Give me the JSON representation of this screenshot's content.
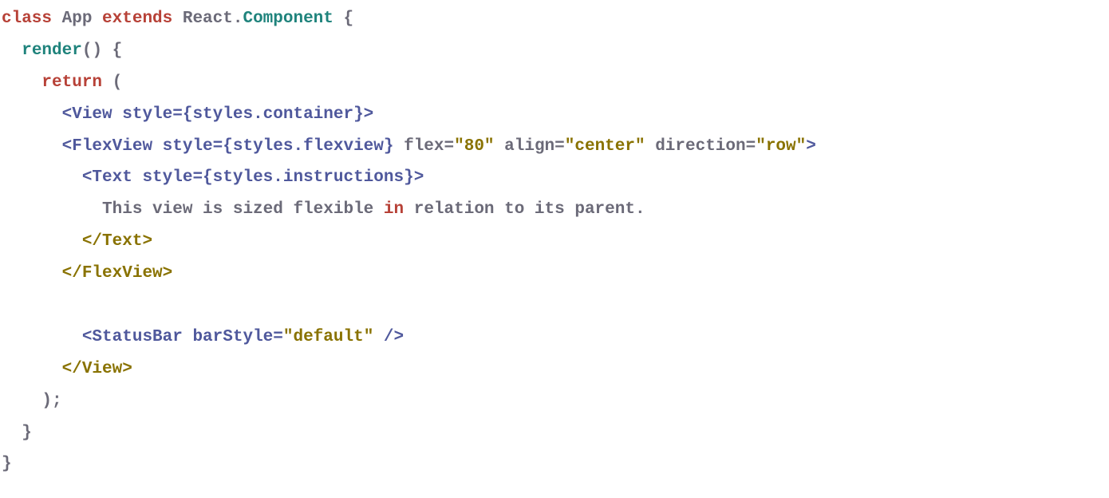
{
  "code": {
    "l1": {
      "a": "class",
      "b": " App ",
      "c": "extends",
      "d": " React.",
      "e": "Component",
      "f": " {"
    },
    "l2": {
      "a": "  ",
      "b": "render",
      "c": "() {"
    },
    "l3": {
      "a": "    ",
      "b": "return",
      "c": " ("
    },
    "l4": {
      "a": "      ",
      "b": "<View style={styles.container}>"
    },
    "l5": {
      "a": "      ",
      "b": "<FlexView style={styles.flexview}",
      "c": " flex=",
      "d": "\"80\"",
      "e": " align=",
      "f": "\"center\"",
      "g": " direction=",
      "h": "\"row\"",
      "i": ">"
    },
    "l6": {
      "a": "        ",
      "b": "<Text style={styles.instructions}>"
    },
    "l7": {
      "a": "          This view is sized flexible ",
      "b": "in",
      "c": " relation to its parent."
    },
    "l8": {
      "a": "        ",
      "b": "</Text>"
    },
    "l9": {
      "a": "      ",
      "b": "</FlexView>"
    },
    "l10": {
      "a": ""
    },
    "l11": {
      "a": "        ",
      "b": "<StatusBar barStyle=",
      "c": "\"default\"",
      "d": " />"
    },
    "l12": {
      "a": "      ",
      "b": "</View>"
    },
    "l13": {
      "a": "    );"
    },
    "l14": {
      "a": "  }"
    },
    "l15": {
      "a": "}"
    }
  }
}
